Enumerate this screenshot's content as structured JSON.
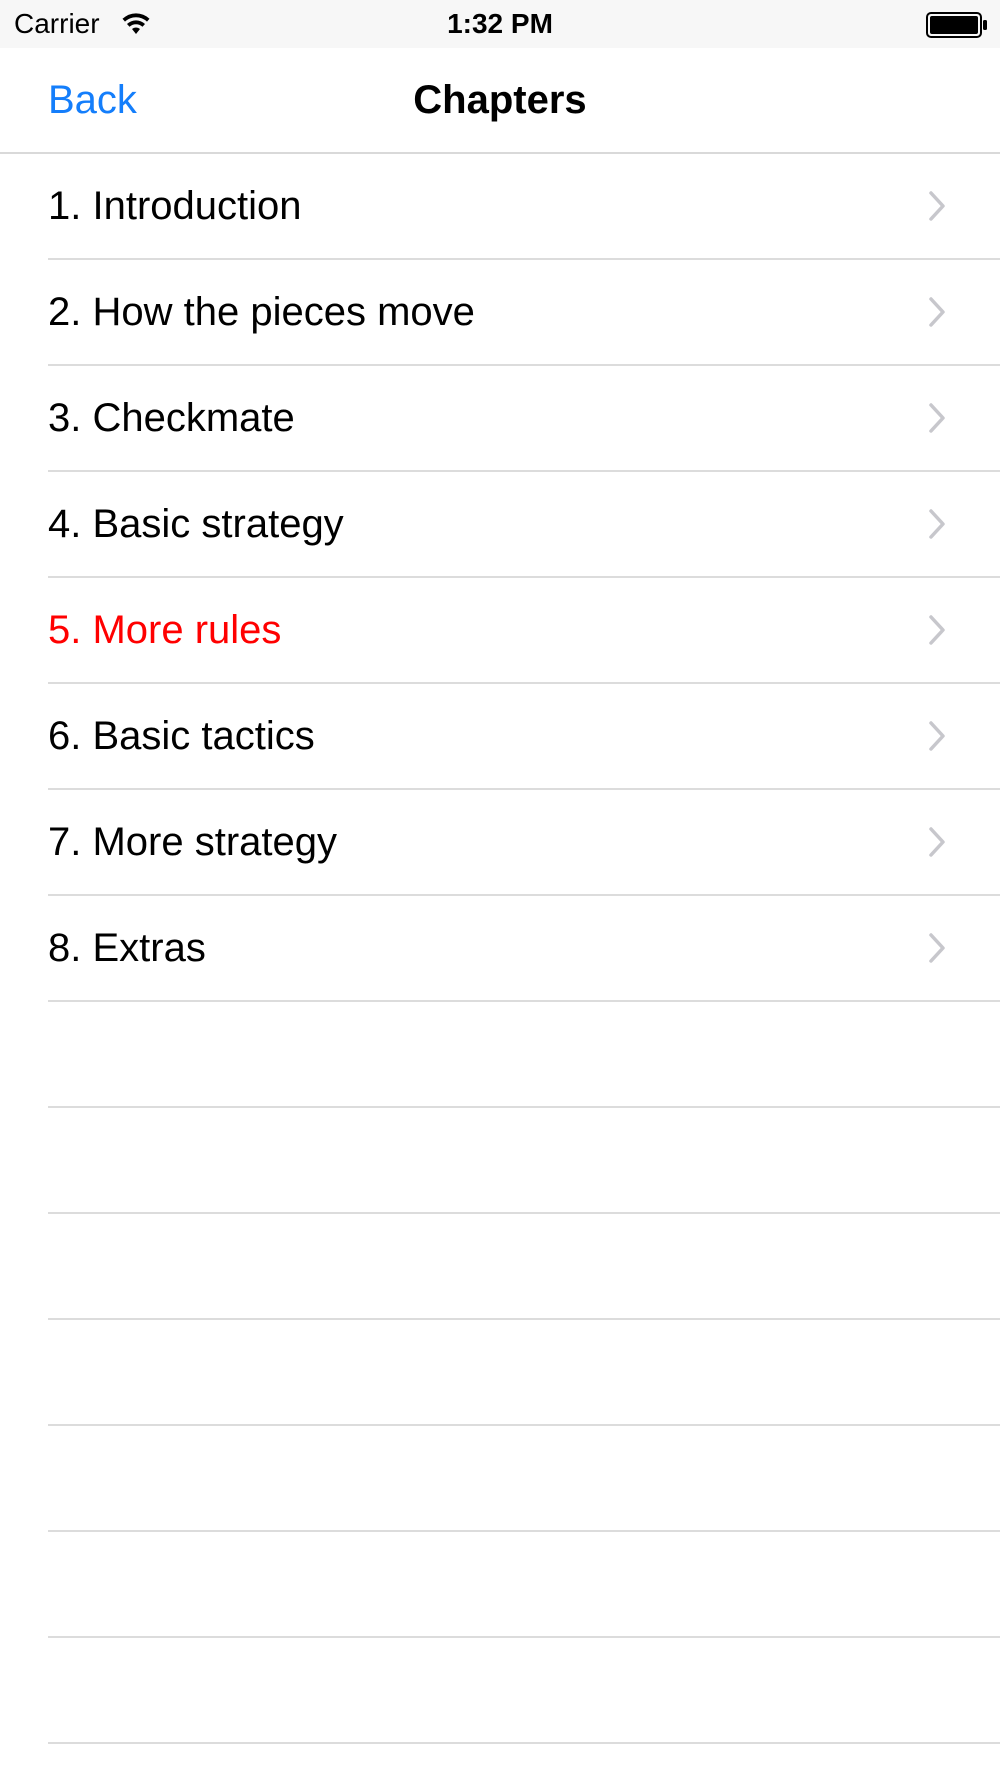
{
  "status_bar": {
    "carrier": "Carrier",
    "time": "1:32 PM",
    "wifi_icon": "wifi-icon",
    "battery_icon": "battery-icon"
  },
  "nav": {
    "back_label": "Back",
    "title": "Chapters"
  },
  "chapters": [
    {
      "label": "1. Introduction"
    },
    {
      "label": "2. How the pieces move"
    },
    {
      "label": "3. Checkmate"
    },
    {
      "label": "4. Basic strategy"
    },
    {
      "label": "5. More rules",
      "highlighted": true
    },
    {
      "label": "6. Basic tactics"
    },
    {
      "label": "7. More strategy"
    },
    {
      "label": "8. Extras"
    }
  ],
  "colors": {
    "accent": "#147efb",
    "highlight": "#ff0000",
    "separator": "#dcdcdc",
    "chevron": "#c7c7cc"
  }
}
